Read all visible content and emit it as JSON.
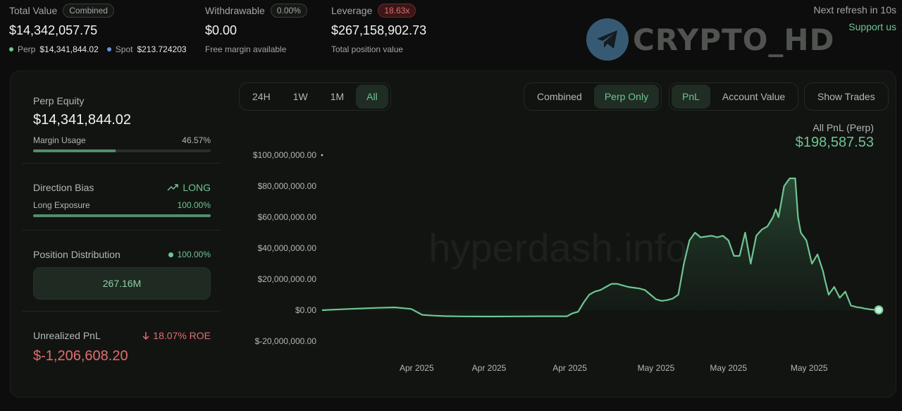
{
  "header": {
    "total_value": {
      "label": "Total Value",
      "badge": "Combined",
      "value": "$14,342,057.75",
      "perp_label": "Perp",
      "perp_value": "$14,341,844.02",
      "spot_label": "Spot",
      "spot_value": "$213.724203"
    },
    "withdrawable": {
      "label": "Withdrawable",
      "badge": "0.00%",
      "value": "$0.00",
      "sub": "Free margin available"
    },
    "leverage": {
      "label": "Leverage",
      "badge": "18.63x",
      "value": "$267,158,902.73",
      "sub": "Total position value"
    },
    "refresh_text": "Next refresh in 10s",
    "support_link": "Support us",
    "watermark_logo_text": "CRYPTO_HD"
  },
  "left_panel": {
    "perp_equity": {
      "label": "Perp Equity",
      "value": "$14,341,844.02",
      "margin_label": "Margin Usage",
      "margin_value": "46.57%",
      "margin_fraction": 0.4657
    },
    "direction": {
      "label": "Direction Bias",
      "value": "LONG",
      "exposure_label": "Long Exposure",
      "exposure_value": "100.00%",
      "exposure_fraction": 1.0
    },
    "distribution": {
      "label": "Position Distribution",
      "value": "100.00%",
      "box_value": "267.16M"
    },
    "unrealized": {
      "label": "Unrealized PnL",
      "roe": "18.07% ROE",
      "value": "$-1,206,608.20"
    }
  },
  "controls": {
    "timeframes": [
      "24H",
      "1W",
      "1M",
      "All"
    ],
    "timeframe_selected": "All",
    "scope": [
      "Combined",
      "Perp Only"
    ],
    "scope_selected": "Perp Only",
    "metric": [
      "PnL",
      "Account Value"
    ],
    "metric_selected": "PnL",
    "show_trades_label": "Show Trades"
  },
  "pnl_summary": {
    "title": "All PnL (Perp)",
    "value": "$198,587.53"
  },
  "colors": {
    "accent": "#6fc592",
    "negative": "#e36d6d",
    "background": "#0c0d0c"
  },
  "chart_data": {
    "type": "area",
    "title": "",
    "xlabel": "",
    "ylabel": "",
    "watermark": "hyperdash.info",
    "x_tick_labels": [
      "Apr 2025",
      "Apr 2025",
      "Apr 2025",
      "May 2025",
      "May 2025",
      "May 2025"
    ],
    "y_tick_labels": [
      "$100,000,000.00",
      "$80,000,000.00",
      "$60,000,000.00",
      "$40,000,000.00",
      "$20,000,000.00",
      "$0.00",
      "$-20,000,000.00"
    ],
    "y_ticks": [
      100000000,
      80000000,
      60000000,
      40000000,
      20000000,
      0,
      -20000000
    ],
    "ylim": [
      -20000000,
      100000000
    ],
    "x_range": [
      0,
      100
    ],
    "x_tick_positions": [
      17,
      30,
      44.5,
      60,
      73,
      87.5
    ],
    "grid": false,
    "series": [
      {
        "x": [
          0,
          5,
          10,
          13,
          16,
          18,
          20,
          22,
          25,
          30,
          35,
          40,
          44,
          45,
          46,
          47,
          48,
          49,
          50,
          51,
          52,
          53,
          54,
          55,
          56,
          57,
          58,
          59,
          60,
          61,
          62,
          63,
          64,
          65,
          66,
          67,
          68,
          69,
          70,
          71,
          72,
          73,
          74,
          75,
          76,
          77,
          78,
          79,
          80,
          81,
          81.5,
          82,
          82.5,
          83,
          84,
          85,
          85.5,
          86,
          87,
          88,
          89,
          90,
          90.3,
          91,
          92,
          93,
          94,
          95,
          96,
          97,
          97.5,
          98,
          98.5,
          99,
          99.5,
          100
        ],
        "y": [
          0,
          800000,
          1500000,
          1800000,
          800000,
          -3000000,
          -3500000,
          -3800000,
          -4000000,
          -4100000,
          -4000000,
          -3900000,
          -3900000,
          -2000000,
          -1000000,
          5000000,
          10000000,
          12000000,
          13000000,
          15000000,
          17000000,
          17000000,
          16000000,
          15000000,
          14500000,
          14000000,
          13000000,
          10000000,
          7000000,
          6000000,
          6500000,
          7500000,
          10000000,
          30000000,
          45000000,
          50000000,
          47000000,
          47500000,
          48000000,
          47000000,
          48000000,
          45000000,
          35000000,
          35000000,
          50000000,
          30000000,
          48000000,
          52000000,
          54000000,
          60000000,
          65000000,
          60000000,
          70000000,
          80000000,
          85000000,
          85000000,
          60000000,
          50000000,
          45000000,
          30000000,
          36000000,
          25000000,
          20000000,
          10000000,
          15000000,
          8000000,
          12000000,
          3000000,
          2000000,
          1500000,
          1000000,
          800000,
          500000,
          300000,
          200000,
          198587
        ]
      }
    ]
  }
}
